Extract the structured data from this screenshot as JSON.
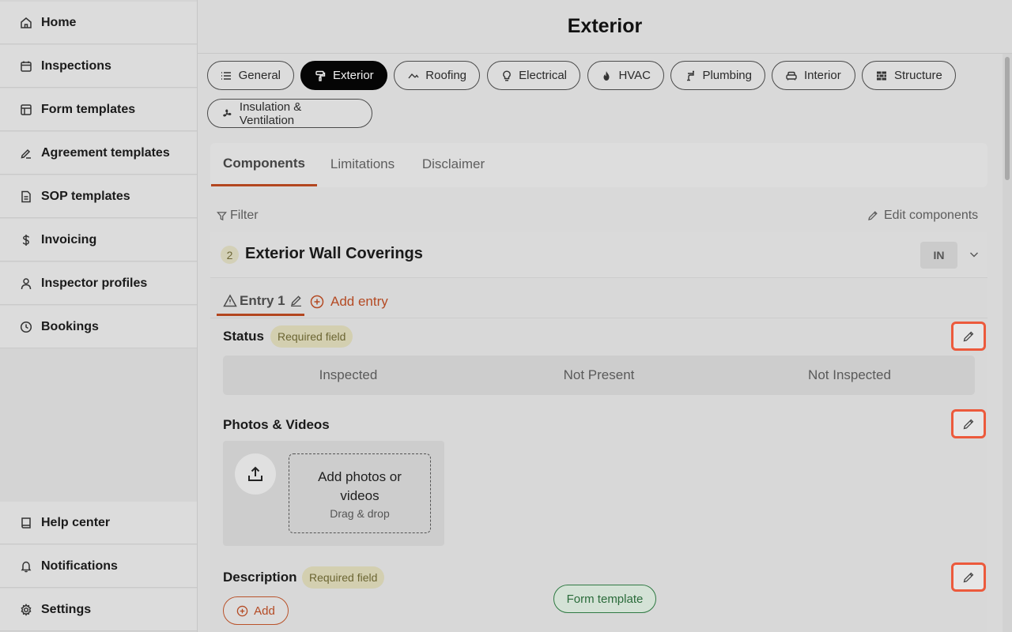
{
  "sidebar": {
    "top_items": [
      {
        "label": "Home",
        "icon": "home-icon"
      },
      {
        "label": "Inspections",
        "icon": "calendar-icon"
      },
      {
        "label": "Form templates",
        "icon": "layout-icon"
      },
      {
        "label": "Agreement templates",
        "icon": "signature-icon"
      },
      {
        "label": "SOP templates",
        "icon": "document-icon"
      },
      {
        "label": "Invoicing",
        "icon": "dollar-icon"
      },
      {
        "label": "Inspector profiles",
        "icon": "user-icon"
      },
      {
        "label": "Bookings",
        "icon": "clock-icon"
      }
    ],
    "bottom_items": [
      {
        "label": "Help center",
        "icon": "book-icon"
      },
      {
        "label": "Notifications",
        "icon": "bell-icon"
      },
      {
        "label": "Settings",
        "icon": "gear-icon"
      }
    ]
  },
  "header": {
    "title": "Exterior"
  },
  "section_chips": [
    {
      "label": "General",
      "icon": "list-icon",
      "active": false
    },
    {
      "label": "Exterior",
      "icon": "paint-roller-icon",
      "active": true
    },
    {
      "label": "Roofing",
      "icon": "roof-icon",
      "active": false
    },
    {
      "label": "Electrical",
      "icon": "lightbulb-icon",
      "active": false
    },
    {
      "label": "HVAC",
      "icon": "flame-icon",
      "active": false
    },
    {
      "label": "Plumbing",
      "icon": "faucet-icon",
      "active": false
    },
    {
      "label": "Interior",
      "icon": "sofa-icon",
      "active": false
    },
    {
      "label": "Structure",
      "icon": "brick-icon",
      "active": false
    },
    {
      "label": "Insulation & Ventilation",
      "icon": "fan-icon",
      "active": false
    }
  ],
  "tabs": [
    {
      "label": "Components",
      "active": true
    },
    {
      "label": "Limitations",
      "active": false
    },
    {
      "label": "Disclaimer",
      "active": false
    }
  ],
  "toolbar": {
    "filter_label": "Filter",
    "edit_components_label": "Edit components"
  },
  "component": {
    "count": "2",
    "title": "Exterior Wall Coverings",
    "status_badge": "IN",
    "entry_label": "Entry 1",
    "add_entry_label": "Add entry",
    "fields": {
      "status": {
        "label": "Status",
        "required_label": "Required field",
        "options": [
          "Inspected",
          "Not Present",
          "Not Inspected"
        ]
      },
      "photos": {
        "label": "Photos & Videos",
        "dropzone_title": "Add photos or videos",
        "dropzone_hint": "Drag & drop"
      },
      "description": {
        "label": "Description",
        "required_label": "Required field",
        "add_label": "Add"
      }
    }
  },
  "form_template_label": "Form template",
  "colors": {
    "accent": "#b3461f",
    "highlight": "#ec5a3c",
    "active_chip": "#050505",
    "required_badge": "#d3cfb0",
    "form_template": "#2f7a43"
  }
}
